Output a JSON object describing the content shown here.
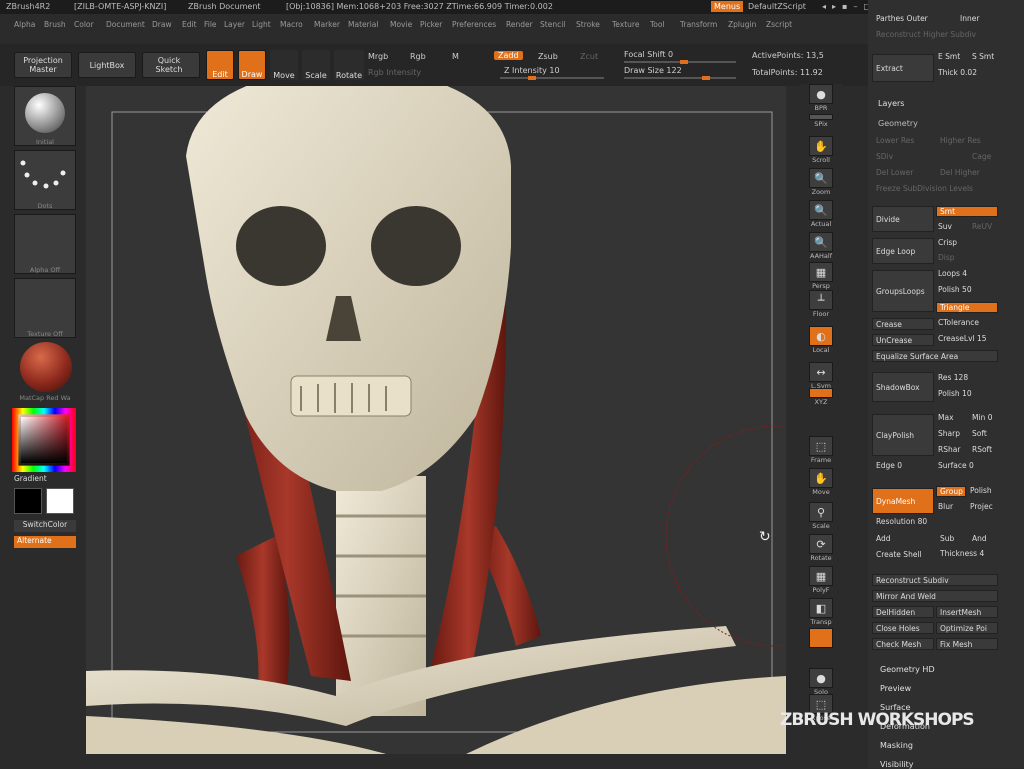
{
  "titlebar": {
    "app": "ZBrush4R2",
    "code": "[ZILB-OMTE-ASPJ-KNZI]",
    "doc": "ZBrush Document",
    "stats": "[Obj:10836] Mem:1068+203 Free:3027 ZTime:66.909 Timer:0.002",
    "menus": "Menus",
    "script": "DefaultZScript"
  },
  "menubar": [
    "Alpha",
    "Brush",
    "Color",
    "Document",
    "Draw",
    "Edit",
    "File",
    "Layer",
    "Light",
    "Macro",
    "Marker",
    "Material",
    "Movie",
    "Picker",
    "Preferences",
    "Render",
    "Stencil",
    "Stroke",
    "Texture",
    "Tool",
    "Transform",
    "Zplugin",
    "Zscript"
  ],
  "toolbar": {
    "projection_master": "Projection Master",
    "lightbox": "LightBox",
    "quick_sketch": "Quick Sketch",
    "edit": "Edit",
    "draw": "Draw",
    "move": "Move",
    "scale": "Scale",
    "rotate": "Rotate",
    "mrgb": "Mrgb",
    "rgb": "Rgb",
    "m": "M",
    "rgb_intensity": "Rgb Intensity",
    "zadd": "Zadd",
    "zsub": "Zsub",
    "zcut": "Zcut",
    "z_intensity": "Z Intensity 10",
    "focal_shift": "Focal Shift 0",
    "draw_size": "Draw Size 122",
    "active_points": "ActivePoints: 13,5",
    "total_points": "TotalPoints: 11.92"
  },
  "leftshelf": {
    "brush_label": "Initial",
    "stroke_label": "Dots",
    "alpha_label": "Alpha Off",
    "texture_label": "Texture Off",
    "material_label": "MatCap Red Wa",
    "gradient": "Gradient",
    "switchcolor": "SwitchColor",
    "alternate": "Alternate"
  },
  "rightshelf": [
    {
      "name": "bpr",
      "label": "BPR",
      "icon": "●"
    },
    {
      "name": "spix",
      "label": "SPix",
      "icon": ""
    },
    {
      "name": "scroll",
      "label": "Scroll",
      "icon": "✋"
    },
    {
      "name": "zoom",
      "label": "Zoom",
      "icon": "🔍"
    },
    {
      "name": "actual",
      "label": "Actual",
      "icon": "🔍"
    },
    {
      "name": "aahalf",
      "label": "AAHalf",
      "icon": "🔍"
    },
    {
      "name": "persp",
      "label": "Persp",
      "icon": "▦"
    },
    {
      "name": "floor",
      "label": "Floor",
      "icon": "┴"
    },
    {
      "name": "local",
      "label": "Local",
      "icon": "◐"
    },
    {
      "name": "lsym",
      "label": "L.Sym",
      "icon": "↔"
    },
    {
      "name": "xyz",
      "label": "XYZ",
      "icon": ""
    },
    {
      "name": "frame",
      "label": "Frame",
      "icon": "⬚"
    },
    {
      "name": "move",
      "label": "Move",
      "icon": "✋"
    },
    {
      "name": "scale",
      "label": "Scale",
      "icon": "⚲"
    },
    {
      "name": "rotate",
      "label": "Rotate",
      "icon": "⟳"
    },
    {
      "name": "polyf",
      "label": "PolyF",
      "icon": "▦"
    },
    {
      "name": "transp",
      "label": "Transp",
      "icon": "◧"
    },
    {
      "name": "ghost",
      "label": "",
      "icon": ""
    },
    {
      "name": "solo",
      "label": "Solo",
      "icon": "●"
    },
    {
      "name": "xpose",
      "label": "Xpose",
      "icon": "⬚"
    }
  ],
  "tray": {
    "parthes_outer": "Parthes Outer",
    "inner": "Inner",
    "reconstruct_higher_subdiv": "Reconstruct Higher Subdiv",
    "extract": "Extract",
    "e_smt": "E Smt",
    "s_smt": "S Smt",
    "thick": "Thick 0.02",
    "layers": "Layers",
    "geometry": "Geometry",
    "lower_res": "Lower Res",
    "higher_res": "Higher Res",
    "sdiv": "SDiv",
    "cage": "Cage",
    "del_lower": "Del Lower",
    "del_higher": "Del Higher",
    "freeze": "Freeze SubDivision Levels",
    "divide": "Divide",
    "smt": "Smt",
    "suv": "Suv",
    "reuv": "ReUV",
    "edge_loop": "Edge Loop",
    "crisp": "Crisp",
    "disp": "Disp",
    "groupsloops": "GroupsLoops",
    "loops": "Loops 4",
    "polish": "Polish 50",
    "triangle": "Triangle",
    "crease": "Crease",
    "ctolerance": "CTolerance",
    "uncrease": "UnCrease",
    "creaselvl": "CreaseLvl 15",
    "equalize": "Equalize Surface Area",
    "shadowbox": "ShadowBox",
    "res": "Res 128",
    "polish2": "Polish 10",
    "claypolish": "ClayPolish",
    "max": "Max",
    "min": "Min 0",
    "sharp": "Sharp",
    "soft": "Soft",
    "rshar": "RShar",
    "rsoft": "RSoft",
    "edge": "Edge 0",
    "surface": "Surface 0",
    "dynamesh": "DynaMesh",
    "group": "Group",
    "polish3": "Polish",
    "blur": "Blur",
    "project": "Projec",
    "resolution": "Resolution 80",
    "add": "Add",
    "sub": "Sub",
    "and": "And",
    "create_shell": "Create Shell",
    "thickness": "Thickness 4",
    "reconstruct_subdiv": "Reconstruct Subdiv",
    "mirror_weld": "Mirror And Weld",
    "delhidden": "DelHidden",
    "insertmesh": "InsertMesh",
    "close_holes": "Close Holes",
    "optimize": "Optimize Poi",
    "check_mesh": "Check Mesh",
    "fix_mesh": "Fix Mesh",
    "geometry_hd": "Geometry HD",
    "preview": "Preview",
    "surface_sec": "Surface",
    "deformation": "Deformation",
    "masking": "Masking",
    "visibility": "Visibility"
  },
  "watermark": "ZBRUSH WORKSHOPS",
  "colors": {
    "accent": "#e0701a",
    "panel": "#2f2f2f",
    "muscle": "#8e2a1e",
    "bone": "#ddd6c2"
  }
}
